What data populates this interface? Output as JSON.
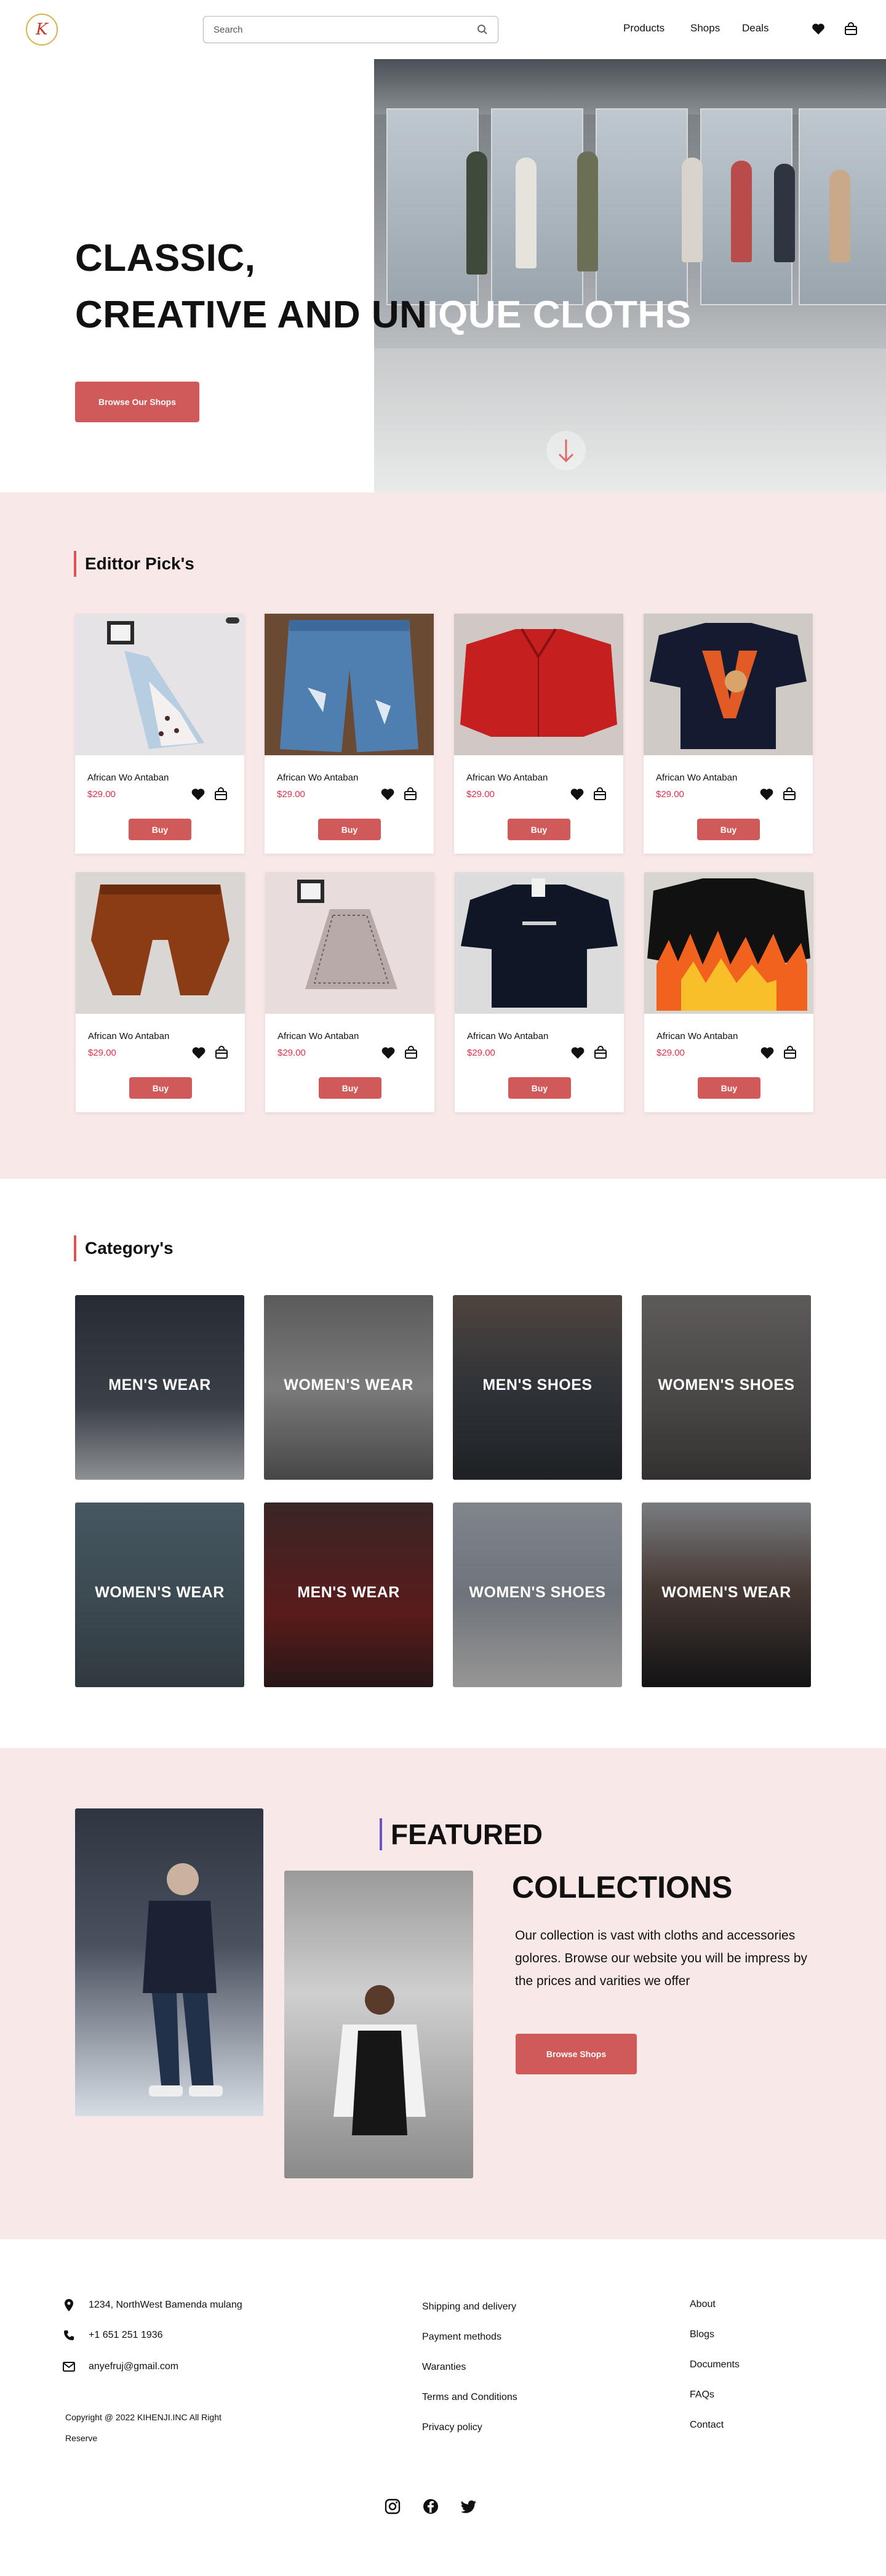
{
  "nav": {
    "logo_text": "K",
    "search_placeholder": "Search",
    "links": [
      "Products",
      "Shops",
      "Deals"
    ]
  },
  "hero": {
    "title_line1": "CLASSIC,",
    "title_line2_a": "CREATIVE AND UN",
    "title_line2_b": "IQUE CLOTHS",
    "button_label": "Browse Our Shops"
  },
  "picks": {
    "title": "Edittor Pick's",
    "products": [
      {
        "name": "African Wo Antaban",
        "price": "$29.00",
        "buy_label": "Buy"
      },
      {
        "name": "African Wo Antaban",
        "price": "$29.00",
        "buy_label": "Buy"
      },
      {
        "name": "African Wo Antaban",
        "price": "$29.00",
        "buy_label": "Buy"
      },
      {
        "name": "African Wo Antaban",
        "price": "$29.00",
        "buy_label": "Buy"
      },
      {
        "name": "African Wo Antaban",
        "price": "$29.00",
        "buy_label": "Buy"
      },
      {
        "name": "African Wo Antaban",
        "price": "$29.00",
        "buy_label": "Buy"
      },
      {
        "name": "African Wo Antaban",
        "price": "$29.00",
        "buy_label": "Buy"
      },
      {
        "name": "African Wo Antaban",
        "price": "$29.00",
        "buy_label": "Buy"
      }
    ]
  },
  "categories": {
    "title": "Category's",
    "items": [
      "MEN'S WEAR",
      "WOMEN'S WEAR",
      "MEN'S SHOES",
      "WOMEN'S SHOES",
      "WOMEN'S WEAR",
      "MEN'S WEAR",
      "WOMEN'S SHOES",
      "WOMEN'S WEAR"
    ]
  },
  "featured": {
    "title1": "FEATURED",
    "title2": "COLLECTIONS",
    "text": "Our collection is vast with cloths and accessories golores. Browse our website you will be impress by the prices and varities we offer",
    "button_label": "Browse  Shops"
  },
  "footer": {
    "address": "1234, NorthWest Bamenda mulang",
    "phone": "+1 651 251 1936",
    "email": "anyefruj@gmail.com",
    "copyright": "Copyright @ 2022 KIHENJI.INC All Right Reserve",
    "col2": [
      "Shipping and delivery",
      "Payment methods",
      "Waranties",
      "Terms and Conditions",
      "Privacy policy"
    ],
    "col3": [
      "About",
      "Blogs",
      "Documents",
      "FAQs",
      "Contact"
    ]
  },
  "colors": {
    "accent": "#d05a5a",
    "price": "#e0304a",
    "section_bg": "#f8e8e8"
  }
}
